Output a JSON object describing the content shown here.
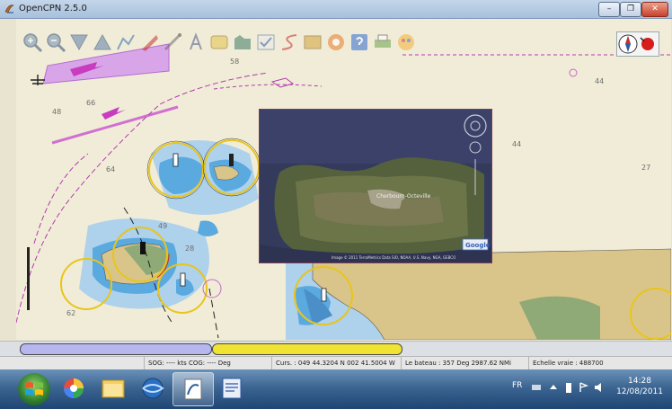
{
  "window": {
    "title": "OpenCPN 2.5.0",
    "minimize_label": "–",
    "restore_label": "❐",
    "close_label": "✕"
  },
  "toolbar": {
    "tools": [
      "zoom-in-icon",
      "zoom-out-icon",
      "scale-down-icon",
      "scale-up-icon",
      "route-icon",
      "mob-icon",
      "measure-icon",
      "text-icon",
      "current-icon",
      "tide-icon",
      "settings-icon",
      "track-icon",
      "chart-bar-icon",
      "ais-icon",
      "help-icon",
      "print-icon",
      "color-scheme-icon"
    ]
  },
  "chart": {
    "depth_labels": [
      "58",
      "44",
      "48",
      "66",
      "64",
      "44",
      "27",
      "49",
      "28",
      "62"
    ],
    "colors": {
      "land": "#d9c58a",
      "shallow": "#5aa9df",
      "mid_water": "#aed1ec",
      "deep_water": "#f1ecd7",
      "intertidal": "#8faa76",
      "route": "#b23bb0",
      "ring": "#e8c51c"
    }
  },
  "overlay": {
    "town_label": "Cherbourg-Octeville",
    "logo": "Google",
    "credit_text": "Image © 2011 TerraMetrics   Data SIO, NOAA, U.S. Navy, NGA, GEBCO"
  },
  "piano": {
    "keys": [
      {
        "color": "#b8b6ee"
      },
      {
        "color": "#f0e332"
      }
    ]
  },
  "status": {
    "sog_cog": "SOG: ---- kts  COG: ---- Deg",
    "cursor": "Curs. : 049 44.3204 N 002 41.5004 W",
    "bearing": "Le bateau : 357 Deg  2987.62 NMi",
    "scale": "Echelle vraie : 488700"
  },
  "taskbar": {
    "items": [
      "start-button",
      "picasa-app",
      "file-explorer-app",
      "opencpn-globe-app",
      "openoffice-app",
      "word-app"
    ],
    "active_item": "openoffice-app",
    "lang": "FR",
    "time": "14:28",
    "date": "12/08/2011"
  }
}
